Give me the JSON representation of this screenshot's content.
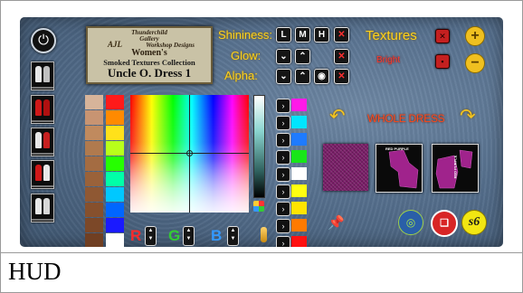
{
  "caption": "HUD",
  "banner": {
    "line1": "Thunderchild",
    "line2": "Gallery",
    "brand": "AJL",
    "line3": "Workshop Designs",
    "audience": "Women's",
    "collection": "Smoked Textures Collection",
    "product": "Uncle O. Dress 1"
  },
  "controls": {
    "shininess": "Shininess:",
    "shininess_buttons": [
      "L",
      "M",
      "H"
    ],
    "glow": "Glow:",
    "alpha": "Alpha:",
    "textures": "Textures",
    "bright": "Bright"
  },
  "rgb": {
    "r": "R",
    "g": "G",
    "b": "B"
  },
  "whole_dress": "WHOLE DRESS",
  "previews": {
    "second": "RED PURPLE",
    "third": "RED PURPLE"
  },
  "logo_text": "s6",
  "colors": {
    "hud_bg": "#56708e",
    "accent_yellow": "#ffd21c",
    "whole_dress": "#ff4a1a",
    "texture_purple": "#7a1e68"
  },
  "left_swatches": [
    "#d7b49a",
    "#c89472",
    "#c08a5e",
    "#b07a4e",
    "#a46c42",
    "#9a623a",
    "#8f5833",
    "#86502d",
    "#7c4828",
    "#703f22"
  ],
  "right_swatches": [
    "#ff1a1a",
    "#ff8a00",
    "#ffe11a",
    "#b8ff1a",
    "#26ff00",
    "#00ffa8",
    "#00c8ff",
    "#0066ff",
    "#1a1aff",
    "#ffffff"
  ],
  "palette2": [
    "#ff1ae8",
    "#00e5ff",
    "#1e7bff",
    "#18e618",
    "#ffffff",
    "#ffff10",
    "#ffe400",
    "#ff7a00",
    "#ff1010"
  ]
}
